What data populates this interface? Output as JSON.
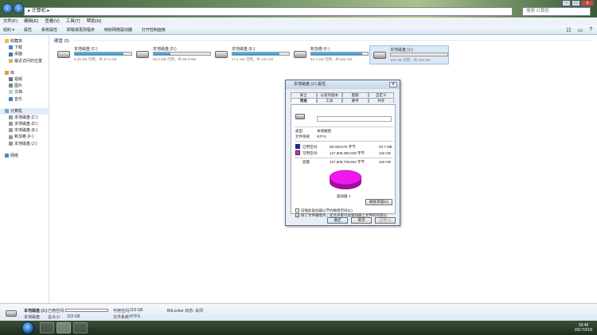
{
  "window": {
    "address": "▸ 计算机 ▸",
    "search_placeholder": "搜索 计算机",
    "min": "–",
    "max": "□",
    "close": "x"
  },
  "menu": [
    "文件(F)",
    "编辑(E)",
    "查看(V)",
    "工具(T)",
    "帮助(H)"
  ],
  "toolbar": [
    "组织 ▾",
    "属性",
    "系统属性",
    "卸载或更改程序",
    "映射网络驱动器",
    "打开控制面板"
  ],
  "sidebar": {
    "favorites": "收藏夹",
    "favorites_items": [
      "下载",
      "桌面",
      "最近访问的位置"
    ],
    "libraries": "库",
    "library_items": [
      "视频",
      "图片",
      "文档",
      "音乐"
    ],
    "computer": "计算机",
    "computer_items": [
      "本地磁盘 (C:)",
      "本地磁盘 (D:)",
      "本地磁盘 (E:)",
      "新加卷 (F:)",
      "本地磁盘 (J:)"
    ],
    "network": "网络"
  },
  "main": {
    "group_header": "硬盘 (5)",
    "drives": [
      {
        "name": "本地磁盘 (C:)",
        "free": "5.26 GB 可用，共 37.2 GB",
        "used": 0.86
      },
      {
        "name": "本地磁盘 (D:)",
        "free": "69.8 MB 可用，共 99.9 MB",
        "used": 0.3
      },
      {
        "name": "本地磁盘 (E:)",
        "free": "17.1 GB 可用，共 102 GB",
        "used": 0.83
      },
      {
        "name": "新加卷 (F:)",
        "free": "81.4 GB 可用，共 825 GB",
        "used": 0.9
      },
      {
        "name": "本地磁盘 (J:)",
        "free": "119 GB 可用，共 119 GB",
        "used": 0.0
      }
    ]
  },
  "dialog": {
    "title": "本地磁盘 (J:) 属性",
    "close": "x",
    "tabs_row1": [
      "安全",
      "以前的版本",
      "配额",
      "自定义"
    ],
    "tabs_row2": [
      "常规",
      "工具",
      "硬件",
      "共享"
    ],
    "type_label": "类型:",
    "type_value": "本地磁盘",
    "fs_label": "文件系统:",
    "fs_value": "NTFS",
    "used_label": "已用空间:",
    "used_bytes": "98,328,576 字节",
    "used_size": "93.7 MB",
    "free_label": "可用空间:",
    "free_bytes": "127,808,380,928 字节",
    "free_size": "119 GB",
    "cap_label": "容量:",
    "cap_bytes": "127,906,709,504 字节",
    "cap_size": "119 GB",
    "drive_label": "驱动器 J",
    "cleanup": "磁盘清理(D)",
    "compress": "压缩此驱动器以节约磁盘空间(C)",
    "index": "除了文件属性外，还允许索引此驱动器上文件的内容(I)",
    "ok": "确定",
    "cancel": "取消",
    "apply": "应用(A)",
    "colors": {
      "used": "#1d1dd8",
      "free": "#e619e6"
    },
    "used_fraction": 0.001
  },
  "details": {
    "name": "本地磁盘 (J:)",
    "used_label": "已用空间:",
    "type": "本地磁盘",
    "total_label": "总大小:",
    "total": "119 GB",
    "free_label": "可用空间:",
    "free": "119 GB",
    "fs_label": "文件系统:",
    "fs": "NTFS",
    "bitlocker": "BitLocker 状态: 关闭"
  },
  "taskbar": {
    "time": "18:48",
    "date": "2017/3/18"
  }
}
